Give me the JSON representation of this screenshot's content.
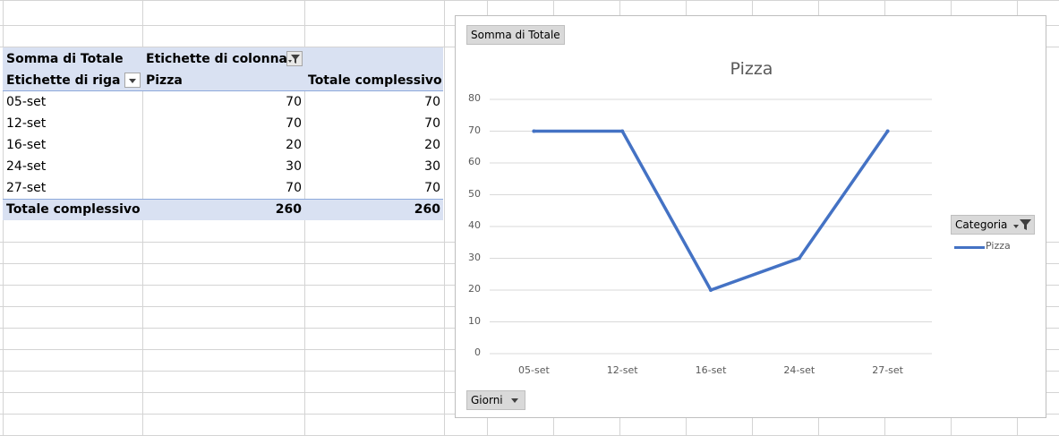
{
  "pivot": {
    "header_value_field": "Somma di Totale",
    "column_labels_title": "Etichette di colonna",
    "row_labels_title": "Etichette di riga",
    "series_col_header": "Pizza",
    "grand_total_header": "Totale complessivo",
    "rows": [
      {
        "label": "05-set",
        "pizza": "70",
        "total": "70"
      },
      {
        "label": "12-set",
        "pizza": "70",
        "total": "70"
      },
      {
        "label": "16-set",
        "pizza": "20",
        "total": "20"
      },
      {
        "label": "24-set",
        "pizza": "30",
        "total": "30"
      },
      {
        "label": "27-set",
        "pizza": "70",
        "total": "70"
      }
    ],
    "grand_total_label": "Totale complessivo",
    "grand_total_pizza": "260",
    "grand_total_total": "260"
  },
  "chart_ui": {
    "value_field_button": "Somma di Totale",
    "axis_field_button": "Giorni",
    "legend_field_button": "Categoria"
  },
  "chart_data": {
    "type": "line",
    "title": "Pizza",
    "categories": [
      "05-set",
      "12-set",
      "16-set",
      "24-set",
      "27-set"
    ],
    "series": [
      {
        "name": "Pizza",
        "values": [
          70,
          70,
          20,
          30,
          70
        ],
        "color": "#4472c4"
      }
    ],
    "ylim": [
      0,
      80
    ],
    "yticks": [
      0,
      10,
      20,
      30,
      40,
      50,
      60,
      70,
      80
    ],
    "grid": true,
    "legend_position": "right"
  }
}
